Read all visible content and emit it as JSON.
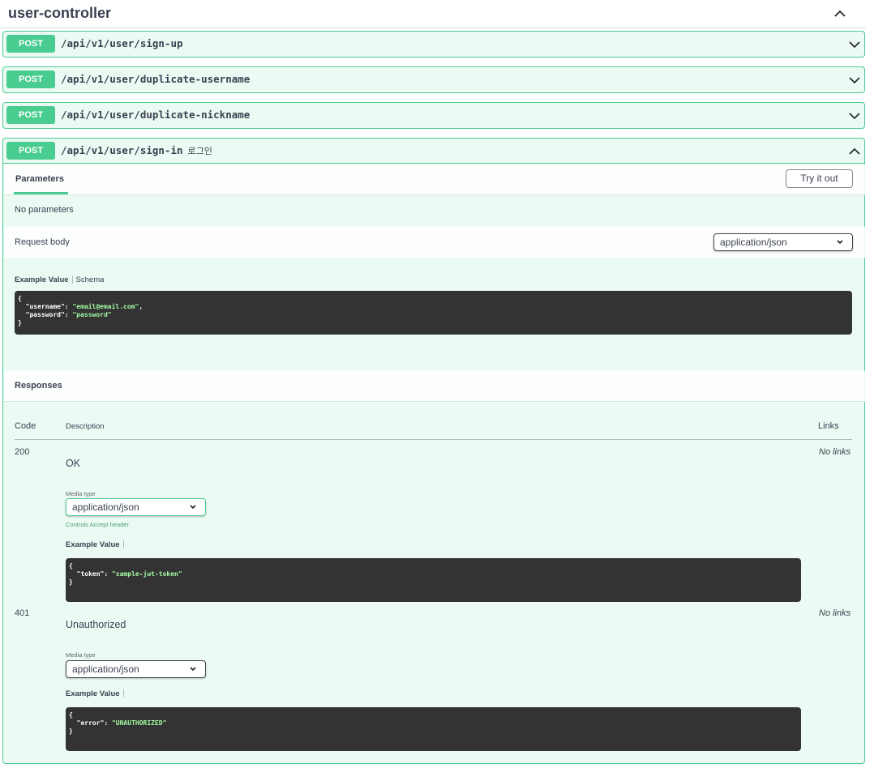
{
  "tag": {
    "title": "user-controller"
  },
  "operations": [
    {
      "method": "POST",
      "path": "/api/v1/user/sign-up"
    },
    {
      "method": "POST",
      "path": "/api/v1/user/duplicate-username"
    },
    {
      "method": "POST",
      "path": "/api/v1/user/duplicate-nickname"
    },
    {
      "method": "POST",
      "path": "/api/v1/user/sign-in",
      "summary": "로그인"
    }
  ],
  "expanded": {
    "tab_parameters": "Parameters",
    "try_it_out": "Try it out",
    "no_parameters": "No parameters",
    "request_body_label": "Request body",
    "request_body_content_type": "application/json",
    "example_value_tab": "Example Value",
    "schema_tab": "Schema",
    "request_example": {
      "line1": "{",
      "username_key": "  \"username\": ",
      "username_val": "\"email@email.com\"",
      "username_tail": ",",
      "password_key": "  \"password\": ",
      "password_val": "\"password\"",
      "close": "}"
    },
    "responses_title": "Responses",
    "columns": {
      "code": "Code",
      "description": "Description",
      "links": "Links"
    },
    "responses": [
      {
        "code": "200",
        "description": "OK",
        "links": "No links",
        "media_type_label": "Media type",
        "media_type": "application/json",
        "controls_note": "Controls Accept header.",
        "example_label": "Example Value",
        "example": {
          "open": "{",
          "key": "  \"token\": ",
          "val": "\"sample-jwt-token\"",
          "close": "}"
        }
      },
      {
        "code": "401",
        "description": "Unauthorized",
        "links": "No links",
        "media_type_label": "Media type",
        "media_type": "application/json",
        "example_label": "Example Value",
        "example": {
          "open": "{",
          "key": "  \"error\": ",
          "val": "\"UNAUTHORIZED\"",
          "close": "}"
        }
      }
    ]
  },
  "colors": {
    "post": "#49cc90",
    "code_bg": "#333333",
    "string": "#a2fca2"
  },
  "icons": {
    "collapse": "chevron-up-icon",
    "expand": "chevron-down-icon",
    "select": "caret-down-icon"
  }
}
